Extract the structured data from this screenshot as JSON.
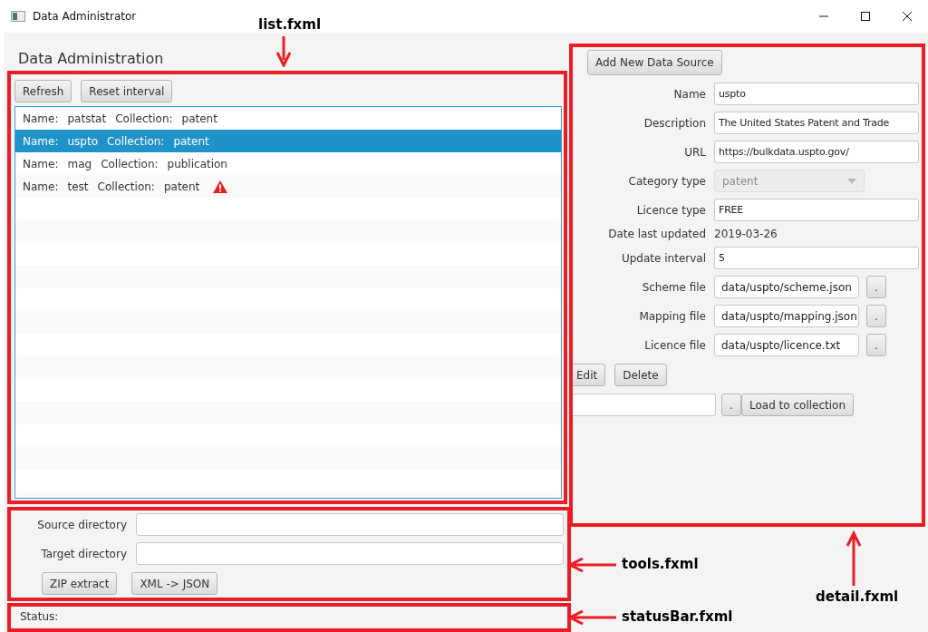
{
  "window": {
    "title": "Data Administrator"
  },
  "heading": "Data Administration",
  "list_panel": {
    "buttons": [
      "Refresh",
      "Reset interval"
    ],
    "items": [
      {
        "name_label": "Name:",
        "name": "patstat",
        "collection_label": "Collection:",
        "collection": "patent",
        "selected": false,
        "warning": false
      },
      {
        "name_label": "Name:",
        "name": "uspto",
        "collection_label": "Collection:",
        "collection": "patent",
        "selected": true,
        "warning": false
      },
      {
        "name_label": "Name:",
        "name": "mag",
        "collection_label": "Collection:",
        "collection": "publication",
        "selected": false,
        "warning": false
      },
      {
        "name_label": "Name:",
        "name": "test",
        "collection_label": "Collection:",
        "collection": "patent",
        "selected": false,
        "warning": true
      }
    ]
  },
  "tools": {
    "fields": [
      {
        "label": "Source directory"
      },
      {
        "label": "Target directory"
      }
    ],
    "buttons": [
      "ZIP extract",
      "XML -> JSON"
    ]
  },
  "status_bar": {
    "label": "Status:"
  },
  "detail": {
    "add_button": "Add New Data Source",
    "fields": [
      {
        "kind": "text",
        "label": "Name",
        "value": "uspto"
      },
      {
        "kind": "text",
        "label": "Description",
        "value": "The United States Patent and Trade"
      },
      {
        "kind": "text",
        "label": "URL",
        "value": "https://bulkdata.uspto.gov/"
      },
      {
        "kind": "select",
        "label": "Category type",
        "value": "patent",
        "disabled": true
      },
      {
        "kind": "text",
        "label": "Licence type",
        "value": "FREE"
      },
      {
        "kind": "static",
        "label": "Date last updated",
        "value": "2019-03-26"
      },
      {
        "kind": "text",
        "label": "Update interval",
        "value": "5"
      },
      {
        "kind": "file",
        "label": "Scheme file",
        "value": "data/uspto/scheme.json",
        "browse": "."
      },
      {
        "kind": "file",
        "label": "Mapping file",
        "value": "data/uspto/mapping.json",
        "browse": "."
      },
      {
        "kind": "file",
        "label": "Licence file",
        "value": "data/uspto/licence.txt",
        "browse": "."
      }
    ],
    "actions": [
      "Edit",
      "Delete"
    ],
    "load": {
      "browse": ".",
      "button": "Load to collection"
    }
  },
  "annotations": [
    "list.fxml",
    "tools.fxml",
    "statusBar.fxml",
    "detail.fxml"
  ]
}
